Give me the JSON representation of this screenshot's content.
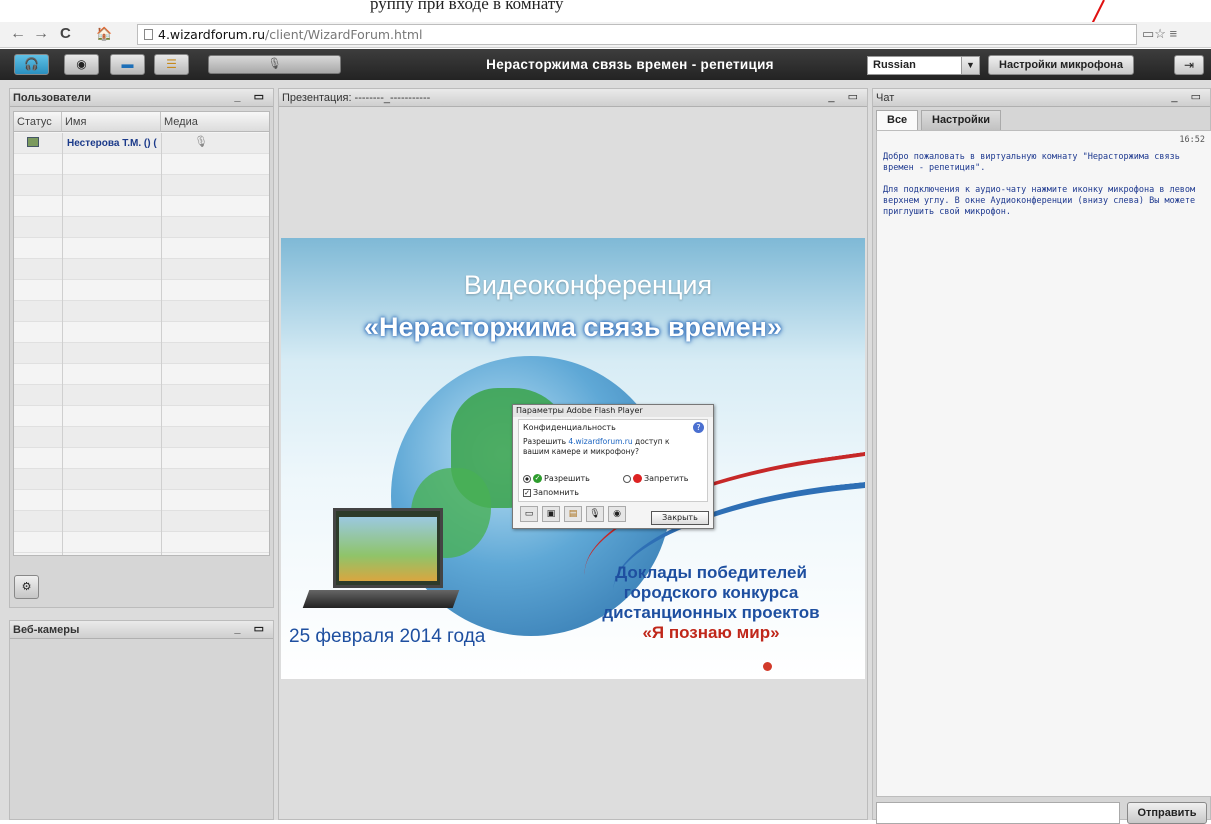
{
  "callout_text": "руппу при вхо­де в комнату",
  "browser": {
    "url_domain": "4.wizardforum.ru",
    "url_path": "/client/WizardForum.html",
    "back": "←",
    "forward": "→",
    "reload": "C",
    "home": "🏠",
    "icons_right": "▭☆  ≡"
  },
  "toolbar": {
    "meeting_title": "Нерасторжима связь времен - репетиция",
    "mic_slider_icon": "🎙",
    "language": "Russian",
    "mic_settings_label": "Настройки микрофона"
  },
  "users_panel": {
    "title": "Пользователи",
    "headers": [
      "Статус",
      "Имя",
      "Медиа"
    ],
    "user_name": "Нестерова Т.М. () (",
    "controls": "_ ▭"
  },
  "webcams_panel": {
    "title": "Веб-камеры",
    "controls": "_ ▭"
  },
  "presentation_panel": {
    "title": "Презентация: --------_-----------",
    "controls": "_ ▭",
    "slide_title_1": "Видеоконференция",
    "slide_title_2": "«Нерасторжима связь времен»",
    "slide_date": "25 февраля 2014 года",
    "slide_subtitle_lines": [
      "Доклады победителей",
      "городского конкурса",
      "дистанционных проектов"
    ],
    "slide_subtitle_red": "«Я познаю мир»"
  },
  "flash_dialog": {
    "title": "Параметры Adobe Flash Player",
    "section": "Конфиденциальность",
    "help": "?",
    "msg_prefix": "Разрешить ",
    "msg_link": "4.wizardforum.ru",
    "msg_suffix": " доступ к вашим камере и микрофону?",
    "allow": "Разрешить",
    "deny": "Запретить",
    "remember": "Запомнить",
    "close": "Закрыть"
  },
  "chat_panel": {
    "title": "Чат",
    "tabs": [
      "Все",
      "Настройки"
    ],
    "time": "16:52",
    "message_1": "Добро пожаловать в виртуальную комнату \"Нерасторжима связь времен - репетиция\".",
    "message_2": "Для подключения к аудио-чату нажмите иконку микрофона в левом верхнем углу. В окне Аудиоконференции (внизу слева) Вы можете приглушить свой микрофон.",
    "send": "Отправить",
    "controls": "_ ▭"
  }
}
